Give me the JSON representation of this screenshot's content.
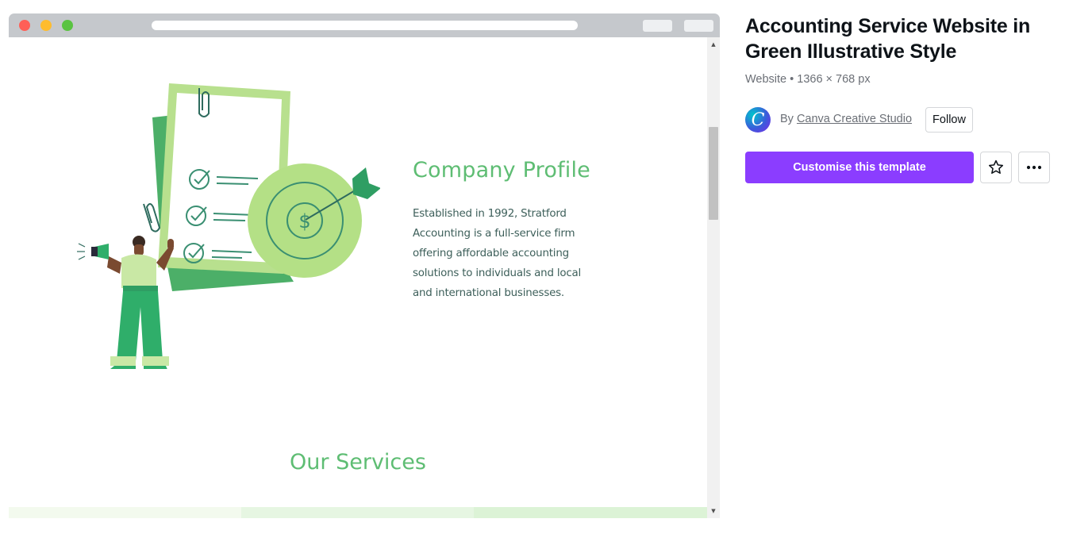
{
  "preview": {
    "company_title": "Company Profile",
    "company_body": "Established in 1992, Stratford Accounting is a full-service firm offering affordable accounting solutions to individuals and local and international businesses.",
    "services_title": "Our Services",
    "scroll_up_glyph": "▲",
    "scroll_down_glyph": "▼"
  },
  "template": {
    "title": "Accounting Service Website in Green Illustrative Style",
    "meta": "Website • 1366 × 768 px",
    "by_prefix": "By",
    "author": "Canva Creative Studio",
    "avatar_letter": "C",
    "follow_label": "Follow",
    "cta_label": "Customise this template"
  },
  "icons": {
    "favorite": "star-icon",
    "more": "more-horizontal-icon",
    "window_close": "close-dot",
    "window_minimize": "minimize-dot",
    "window_maximize": "maximize-dot"
  },
  "colors": {
    "accent_green": "#5ebd73",
    "body_text": "#3d5f5a",
    "cta_purple": "#8b3dff",
    "chrome_gray": "#c5c8cc"
  }
}
